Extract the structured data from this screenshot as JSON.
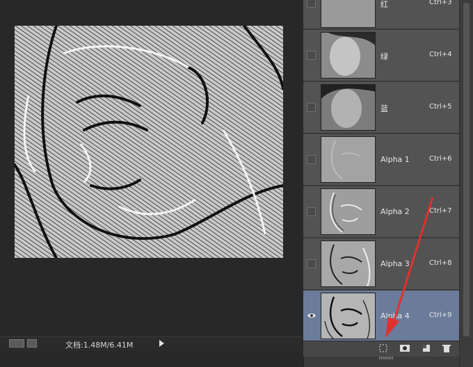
{
  "status": {
    "doc_info": "文档:1.48M/6.41M"
  },
  "channels": [
    {
      "name": "红",
      "shortcut": "Ctrl+3",
      "visible": false
    },
    {
      "name": "绿",
      "shortcut": "Ctrl+4",
      "visible": false
    },
    {
      "name": "蓝",
      "shortcut": "Ctrl+5",
      "visible": false
    },
    {
      "name": "Alpha 1",
      "shortcut": "Ctrl+6",
      "visible": false
    },
    {
      "name": "Alpha 2",
      "shortcut": "Ctrl+7",
      "visible": false
    },
    {
      "name": "Alpha 3",
      "shortcut": "Ctrl+8",
      "visible": false
    },
    {
      "name": "Alpha 4",
      "shortcut": "Ctrl+9",
      "visible": true,
      "selected": true
    }
  ],
  "footer_icons": [
    "load-selection-icon",
    "save-selection-icon",
    "new-channel-icon",
    "delete-channel-icon"
  ],
  "colors": {
    "selected_row": "#6a7c99",
    "annotation_arrow": "#e0312f"
  }
}
